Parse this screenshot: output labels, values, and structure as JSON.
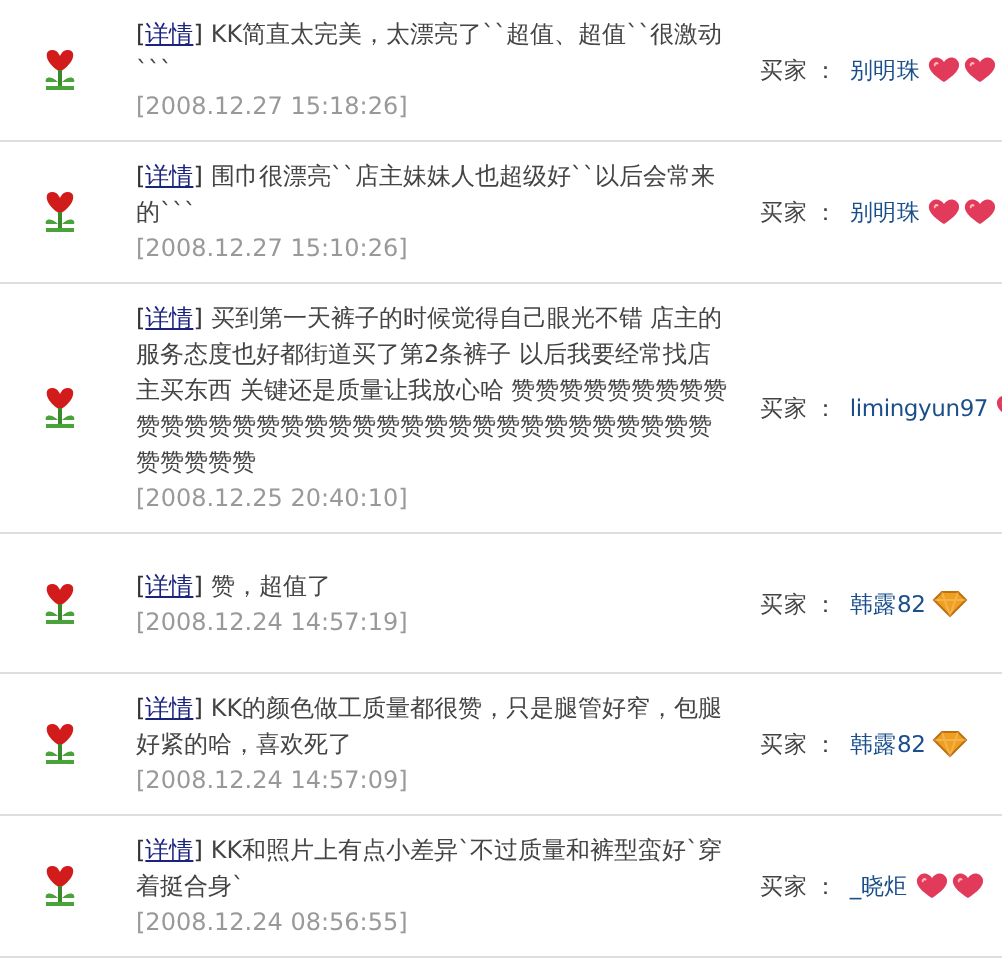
{
  "link_brackets": {
    "open": "[",
    "close": "]"
  },
  "reviews": [
    {
      "link": "详情",
      "text": "KK简直太完美，太漂亮了``超值、超值``很激动```",
      "time": "[2008.12.27 15:18:26]",
      "buyer_label": "买家 ：",
      "buyer": "别明珠",
      "rank_icons": [
        {
          "kind": "heart"
        },
        {
          "kind": "heart"
        }
      ]
    },
    {
      "link": "详情",
      "text": "围巾很漂亮``店主妹妹人也超级好``以后会常来的```",
      "time": "[2008.12.27 15:10:26]",
      "buyer_label": "买家 ：",
      "buyer": "别明珠",
      "rank_icons": [
        {
          "kind": "heart"
        },
        {
          "kind": "heart"
        }
      ]
    },
    {
      "link": "详情",
      "text": "买到第一天裤子的时候觉得自己眼光不错 店主的服务态度也好都街道买了第2条裤子 以后我要经常找店主买东西 关键还是质量让我放心哈 赞赞赞赞赞赞赞赞赞赞赞赞赞赞赞赞赞赞赞赞赞赞赞赞赞赞赞赞赞赞赞赞赞赞赞赞赞赞",
      "time": "[2008.12.25 20:40:10]",
      "buyer_label": "买家 ：",
      "buyer": "limingyun97",
      "rank_icons": [
        {
          "kind": "heart"
        }
      ]
    },
    {
      "link": "详情",
      "text": "赞，超值了",
      "time": "[2008.12.24 14:57:19]",
      "buyer_label": "买家 ：",
      "buyer": "韩露82",
      "rank_icons": [
        {
          "kind": "diamond"
        }
      ]
    },
    {
      "link": "详情",
      "text": "KK的颜色做工质量都很赞，只是腿管好窄，包腿好紧的哈，喜欢死了",
      "time": "[2008.12.24 14:57:09]",
      "buyer_label": "买家 ：",
      "buyer": "韩露82",
      "rank_icons": [
        {
          "kind": "diamond"
        }
      ]
    },
    {
      "link": "详情",
      "text": "KK和照片上有点小差异`不过质量和裤型蛮好`穿着挺合身`",
      "time": "[2008.12.24 08:56:55]",
      "buyer_label": "买家 ：",
      "buyer": "_晓炬",
      "rank_icons": [
        {
          "kind": "heart"
        },
        {
          "kind": "heart"
        }
      ]
    }
  ]
}
